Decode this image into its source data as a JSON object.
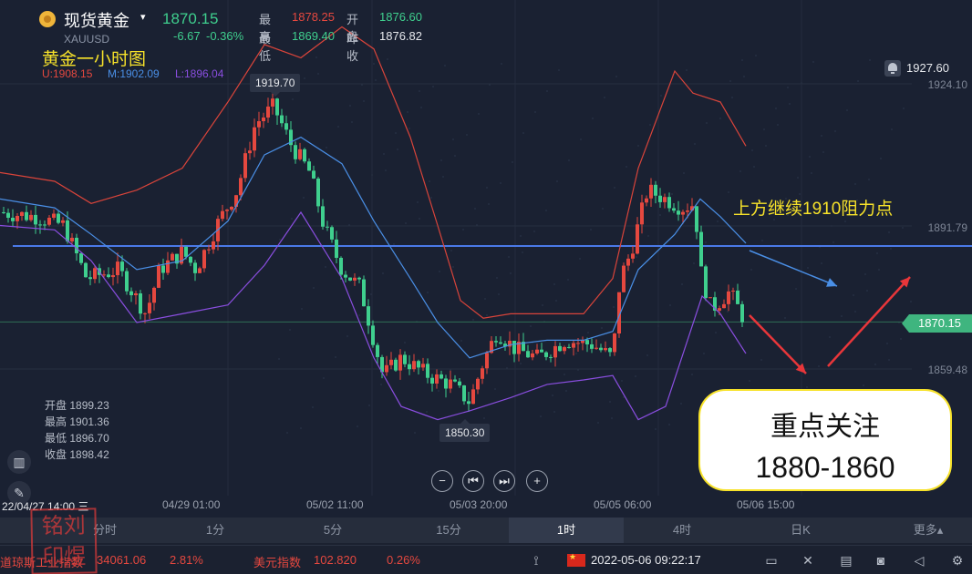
{
  "header": {
    "name": "现货黄金",
    "caret": "▾",
    "code": "XAUUSD",
    "price": "1870.15",
    "change": "-6.67",
    "change_pct": "-0.36%",
    "high_label": "最高",
    "high": "1878.25",
    "open_label": "开盘",
    "open": "1876.60",
    "low_label": "最低",
    "low": "1869.40",
    "prev_label": "昨收",
    "prev": "1876.82"
  },
  "chart_title": "黄金一小时图",
  "bands_legend": {
    "u": "U:1908.15",
    "m": "M:1902.09",
    "l": "L:1896.04"
  },
  "colors": {
    "up": "#e5483f",
    "down": "#3fcf8e",
    "band_upper": "#d9443a",
    "band_mid": "#4a8fe6",
    "band_lower": "#8a4ee0",
    "hline": "#4a79e8",
    "accent_yellow": "#f7e22a"
  },
  "y_axis": {
    "top": "1927.60",
    "labels": [
      "1924.10",
      "1891.79",
      "1859.48"
    ],
    "current": "1870.15"
  },
  "callouts": {
    "high": "1919.70",
    "low": "1850.30"
  },
  "note_text": "上方继续1910阻力点",
  "focus": {
    "title": "重点关注",
    "range": "1880-1860"
  },
  "ohlc_panel": {
    "open_label": "开盘",
    "open": "1899.23",
    "high_label": "最高",
    "high": "1901.36",
    "low_label": "最低",
    "low": "1896.70",
    "close_label": "收盘",
    "close": "1898.42"
  },
  "x_axis": {
    "start": "22/04/27 14:00 三",
    "labels": [
      "04/29 01:00",
      "05/02 11:00",
      "05/03 20:00",
      "05/05 06:00",
      "05/06 15:00"
    ]
  },
  "nav": {
    "zoom_out": "−",
    "first": "⏮",
    "last": "⏭",
    "zoom_in": "+"
  },
  "timeframes": [
    "分时",
    "1分",
    "5分",
    "15分",
    "1时",
    "4时",
    "日K",
    "更多▴"
  ],
  "active_timeframe": "1时",
  "status": {
    "dow_name": "道琼斯工业指数",
    "dow_value": "34061.06",
    "dow_pct": "2.81%",
    "usd_name": "美元指数",
    "usd_value": "102.820",
    "usd_pct": "0.26%",
    "datetime": "2022-05-06 09:22:17"
  },
  "stamp": "铭刘印煜",
  "chart_data": {
    "type": "line",
    "title": "黄金一小时图",
    "x": [
      "04/29 01:00",
      "05/02 11:00",
      "05/03 20:00",
      "05/05 06:00",
      "05/06 15:00"
    ],
    "series": [
      {
        "name": "U",
        "values": [
          1900,
          1936,
          1878,
          1926,
          1902
        ]
      },
      {
        "name": "M",
        "values": [
          1893,
          1917,
          1862,
          1880,
          1893
        ]
      },
      {
        "name": "L",
        "values": [
          1880,
          1893,
          1847,
          1858,
          1863
        ]
      }
    ],
    "ylim": [
      1845,
      1930
    ],
    "annotations": [
      "1919.70",
      "1850.30",
      "上方继续1910阻力点",
      "重点关注",
      "1880-1860"
    ]
  }
}
